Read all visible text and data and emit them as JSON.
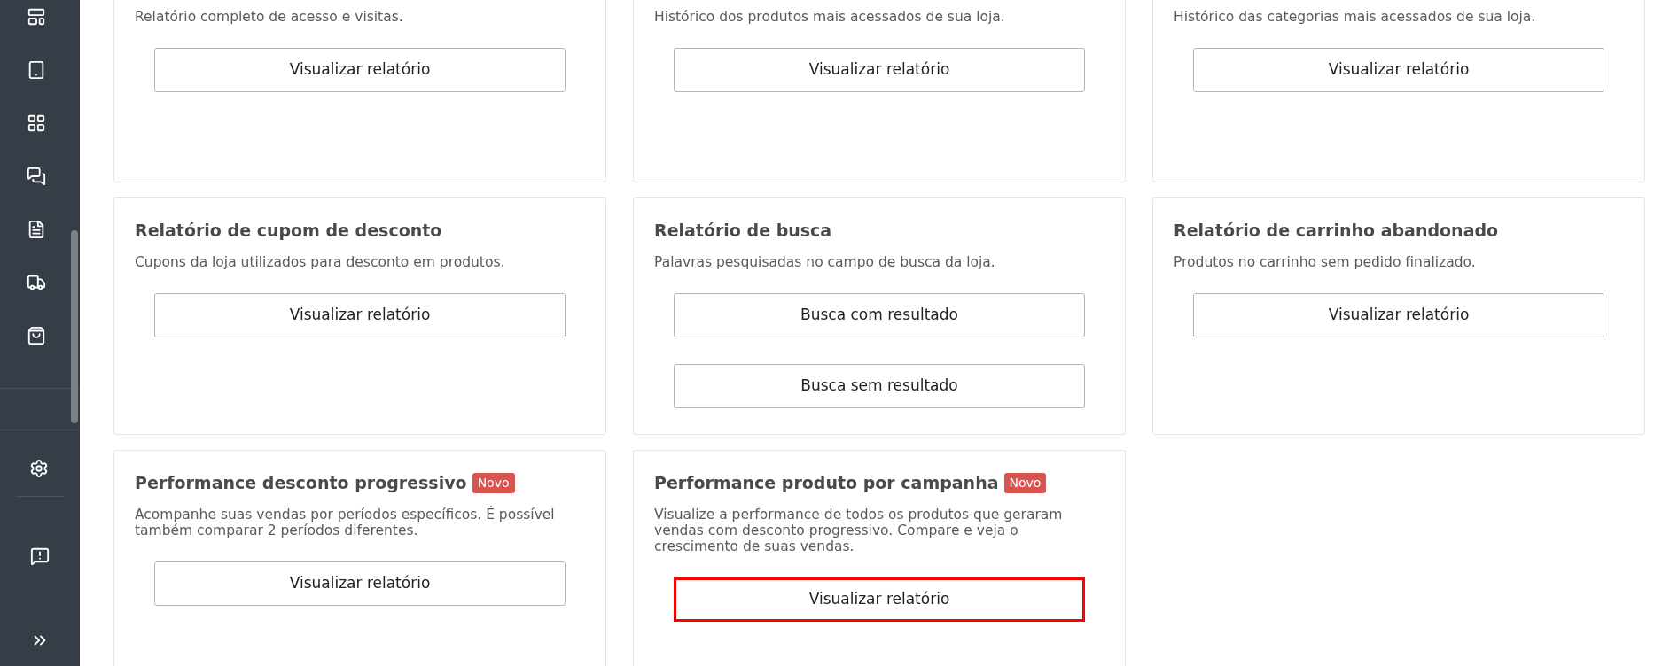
{
  "cards": [
    {
      "description": "Relatório completo de acesso e visitas.",
      "buttons": [
        {
          "label": "Visualizar relatório",
          "highlighted": false
        }
      ]
    },
    {
      "description": "Histórico dos produtos mais acessados de sua loja.",
      "buttons": [
        {
          "label": "Visualizar relatório",
          "highlighted": false
        }
      ]
    },
    {
      "description": "Histórico das categorias mais acessados de sua loja.",
      "buttons": [
        {
          "label": "Visualizar relatório",
          "highlighted": false
        }
      ]
    },
    {
      "title": "Relatório de cupom de desconto",
      "description": "Cupons da loja utilizados para desconto em produtos.",
      "buttons": [
        {
          "label": "Visualizar relatório",
          "highlighted": false
        }
      ]
    },
    {
      "title": "Relatório de busca",
      "description": "Palavras pesquisadas no campo de busca da loja.",
      "buttons": [
        {
          "label": "Busca com resultado",
          "highlighted": false
        },
        {
          "label": "Busca sem resultado",
          "highlighted": false
        }
      ]
    },
    {
      "title": "Relatório de carrinho abandonado",
      "description": "Produtos no carrinho sem pedido finalizado.",
      "buttons": [
        {
          "label": "Visualizar relatório",
          "highlighted": false
        }
      ]
    },
    {
      "title": "Performance desconto progressivo",
      "description": "Acompanhe suas vendas por períodos específicos. É possível também comparar 2 períodos diferentes.",
      "badge": "Novo",
      "buttons": [
        {
          "label": "Visualizar relatório",
          "highlighted": false
        }
      ]
    },
    {
      "title": "Performance produto por campanha",
      "description": "Visualize a performance de todos os produtos que geraram vendas com desconto progressivo. Compare e veja o crescimento de suas vendas.",
      "badge": "Novo",
      "buttons": [
        {
          "label": "Visualizar relatório",
          "highlighted": true
        }
      ]
    }
  ]
}
